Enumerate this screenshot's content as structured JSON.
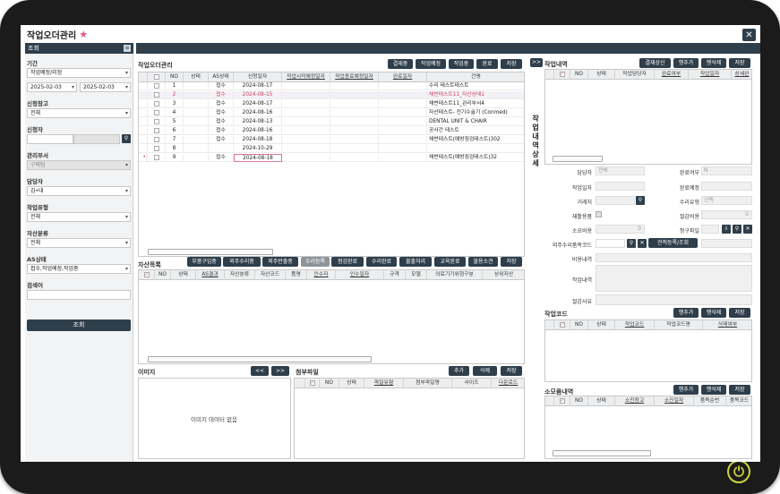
{
  "app": {
    "title": "작업오더관리",
    "close": "✕"
  },
  "sidebar": {
    "header": "조회",
    "period_label": "기간",
    "period_value": "작업예정/미정",
    "date_from": "2025-02-03",
    "date_to": "2025-02-03",
    "warehouse_label": "신청창고",
    "warehouse_value": "전체",
    "requester_label": "신청자",
    "manager_label": "관리부서",
    "manager_value": "구매팀",
    "owner_label": "담당자",
    "owner_value": "김•대",
    "worktype_label": "작업유형",
    "worktype_value": "전체",
    "asset_label": "자산분류",
    "asset_value": "전체",
    "as_label": "AS상태",
    "as_value": "접수,작업예정,작업중",
    "keyword_label": "검색어",
    "search_button": "조회"
  },
  "orders": {
    "title": "작업오더관리",
    "buttons": [
      "결재중",
      "작업예정",
      "작업중",
      "완료",
      "저장"
    ],
    "columns": [
      "NO",
      "상태",
      "AS상태",
      "신청일자",
      "작업시작예정일자",
      "작업종료예정일자",
      "완료일자",
      "건명"
    ],
    "rows": [
      {
        "no": "1",
        "status": "",
        "as": "접수",
        "date": "2024-08-17",
        "name": "수리 테스트테스트",
        "red": false
      },
      {
        "no": "2",
        "status": "",
        "as": "접수",
        "date": "2024-08-15",
        "name": "채번테스트11_자산상태1",
        "red": true
      },
      {
        "no": "3",
        "status": "",
        "as": "접수",
        "date": "2024-08-17",
        "name": "채번테스트11_관리부서4",
        "red": false
      },
      {
        "no": "4",
        "status": "",
        "as": "접수",
        "date": "2024-08-16",
        "name": "자산테스트- 전기수술기 (Conmed)",
        "red": false
      },
      {
        "no": "5",
        "status": "",
        "as": "접수",
        "date": "2024-08-13",
        "name": "DENTAL UNIT & CHAIR",
        "red": false
      },
      {
        "no": "6",
        "status": "",
        "as": "접수",
        "date": "2024-08-16",
        "name": "공사건 테스트",
        "red": false
      },
      {
        "no": "7",
        "status": "",
        "as": "접수",
        "date": "2024-08-18",
        "name": "채번테스트(예방점검테스트)302",
        "red": false
      },
      {
        "no": "8",
        "status": "",
        "as": "",
        "date": "2024-10-29",
        "name": "",
        "red": false
      },
      {
        "no": "9",
        "status": "",
        "as": "접수",
        "date": "2024-08-18",
        "name": "채번테스트(예방점검테스트)32",
        "red": false
      }
    ]
  },
  "assets": {
    "title": "자산목록",
    "buttons": [
      "부품구입중",
      "외주수리중",
      "외주반출중",
      "수리등록",
      "점검완료",
      "수리완료",
      "불출처리",
      "교육완료",
      "불용소견",
      "저장"
    ],
    "columns": [
      "NO",
      "상태",
      "AS결과",
      "자산분류",
      "자산코드",
      "품명",
      "인수자",
      "인수일자",
      "규격",
      "모델",
      "의료기기위험구분",
      "상위자산"
    ]
  },
  "images": {
    "title": "이미지",
    "prev": "<<",
    "next": ">>",
    "empty": "이미지 데이터 없음"
  },
  "files": {
    "title": "첨부파일",
    "buttons": [
      "추가",
      "삭제",
      "저장"
    ],
    "columns": [
      "NO",
      "상태",
      "파일유형",
      "첨부파일명",
      "사이즈",
      "다운로드"
    ]
  },
  "detail": {
    "title": "작업내역",
    "toggle": ">>",
    "buttons": [
      "결재상신",
      "행추가",
      "행삭제",
      "저장"
    ],
    "columns": [
      "NO",
      "상태",
      "작업담당자",
      "완료여부",
      "작업일자",
      "상세완"
    ],
    "side_label": "작업내역상세",
    "fields": {
      "owner": "담당자",
      "owner_value": "전체",
      "done": "완료여부",
      "done_value": "N",
      "workdate": "작업일자",
      "planned": "완료예정",
      "vendor": "거래처",
      "repairtype": "수리유형",
      "repairtype_value": "선택",
      "reuse": "재활용품",
      "reduce": "절감비용",
      "reduce_value": "0",
      "cost": "소요비용",
      "cost_value": "0",
      "invoice": "청구파일",
      "outcode": "외주수리품목코드",
      "estimate": "견적등록/조회",
      "costdetail": "비용내역",
      "workdetail": "작업내역",
      "reason": "절감사유"
    }
  },
  "workcode": {
    "title": "작업코드",
    "buttons": [
      "행추가",
      "행삭제",
      "저장"
    ],
    "columns": [
      "NO",
      "상태",
      "작업코드",
      "작업코드명",
      "삭제여부"
    ]
  },
  "consum": {
    "title": "소모품내역",
    "buttons": [
      "행추가",
      "행삭제",
      "저장"
    ],
    "columns": [
      "NO",
      "상태",
      "소진창고",
      "소진일자",
      "품목순번",
      "품목코드"
    ]
  }
}
